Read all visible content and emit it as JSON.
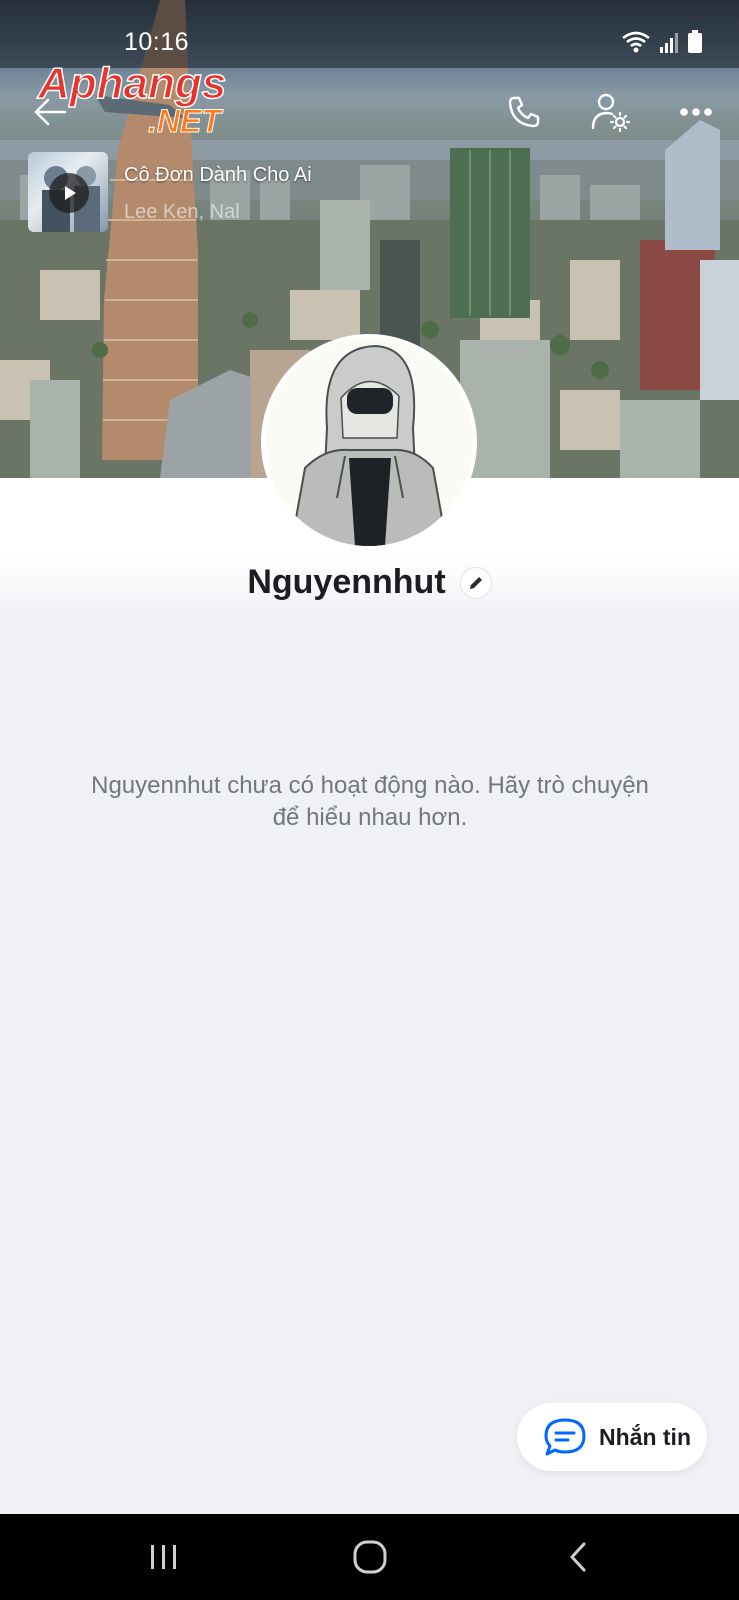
{
  "status_bar": {
    "time": "10:16"
  },
  "watermark": {
    "line1": "Aphangs",
    "line2": ".NET"
  },
  "header": {
    "back_icon": "arrow-left-icon",
    "call_icon": "phone-icon",
    "settings_icon": "user-settings-icon",
    "more_icon": "more-horizontal-icon"
  },
  "music": {
    "title": "Cô Đơn Dành Cho Ai",
    "artist": "Lee Ken, Nal"
  },
  "profile": {
    "name": "Nguyennhut",
    "empty_message": "Nguyennhut chưa có hoạt động nào. Hãy trò chuyện để hiểu nhau hơn."
  },
  "actions": {
    "message_label": "Nhắn tin"
  },
  "colors": {
    "accent": "#0068ff",
    "background": "#f0f1f5",
    "text": "#1c1d20",
    "muted": "#72777f"
  }
}
